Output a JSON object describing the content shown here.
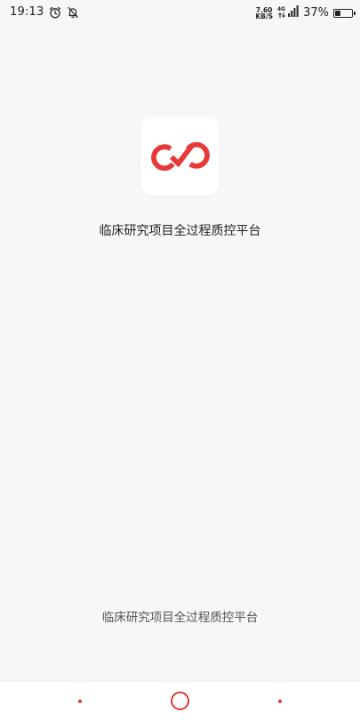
{
  "status_bar": {
    "time": "19:13",
    "net_speed_value": "7.60",
    "net_speed_unit": "KB/S",
    "network_type": "4G",
    "battery_percent": "37%",
    "battery_level": 0.37
  },
  "app": {
    "title": "临床研究项目全过程质控平台",
    "footer_text": "临床研究项目全过程质控平台",
    "brand_color": "#e8393a"
  },
  "nav": {
    "accent_color": "#e03a3a"
  },
  "icons": {
    "alarm": "alarm-clock-icon",
    "notifications_off": "bell-off-icon",
    "signal": "signal-bars-icon",
    "battery": "battery-icon",
    "logo": "infinity-check-logo-icon"
  }
}
